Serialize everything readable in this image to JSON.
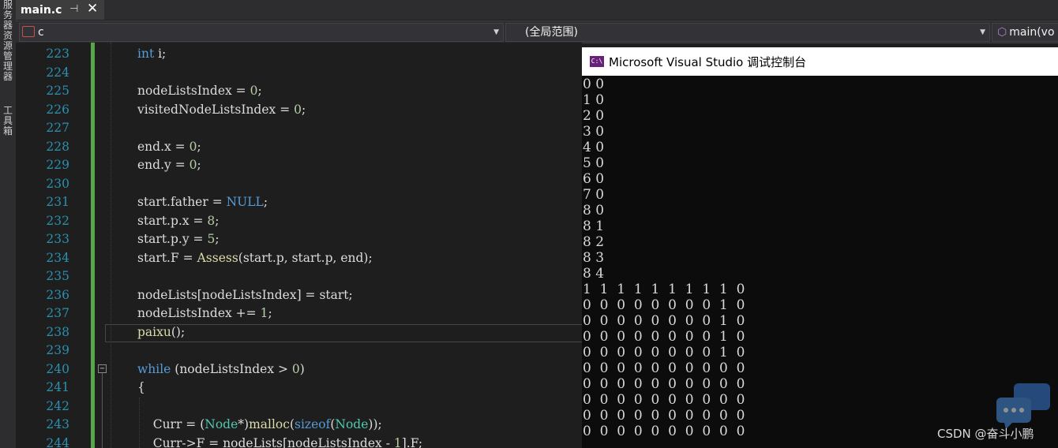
{
  "sidebar": {
    "vertical_text_1": "服务器资源管理器",
    "vertical_text_2": "工具箱"
  },
  "tab": {
    "title": "main.c",
    "pin": "⊣",
    "close": "✕"
  },
  "nav": {
    "project": "c",
    "scope": "(全局范围)",
    "member": "main(vo"
  },
  "editor": {
    "lines": [
      {
        "num": "223",
        "code": "    <span class=\"kw\">int</span> i;"
      },
      {
        "num": "224",
        "code": ""
      },
      {
        "num": "225",
        "code": "    nodeListsIndex = <span class=\"num\">0</span>;"
      },
      {
        "num": "226",
        "code": "    visitedNodeListsIndex = <span class=\"num\">0</span>;"
      },
      {
        "num": "227",
        "code": ""
      },
      {
        "num": "228",
        "code": "    end.x = <span class=\"num\">0</span>;"
      },
      {
        "num": "229",
        "code": "    end.y = <span class=\"num\">0</span>;"
      },
      {
        "num": "230",
        "code": ""
      },
      {
        "num": "231",
        "code": "    start.father = <span class=\"kw\">NULL</span>;"
      },
      {
        "num": "232",
        "code": "    start.p.x = <span class=\"num\">8</span>;"
      },
      {
        "num": "233",
        "code": "    start.p.y = <span class=\"num\">5</span>;"
      },
      {
        "num": "234",
        "code": "    start.F = <span class=\"fn\">Assess</span>(start.p, start.p, end);"
      },
      {
        "num": "235",
        "code": ""
      },
      {
        "num": "236",
        "code": "    nodeLists[nodeListsIndex] = start;"
      },
      {
        "num": "237",
        "code": "    nodeListsIndex += <span class=\"num\">1</span>;"
      },
      {
        "num": "238",
        "code": "    <span class=\"fn\">paixu</span>();"
      },
      {
        "num": "239",
        "code": ""
      },
      {
        "num": "240",
        "code": "    <span class=\"kw\">while</span> (nodeListsIndex > <span class=\"num\">0</span>)"
      },
      {
        "num": "241",
        "code": "    {"
      },
      {
        "num": "242",
        "code": ""
      },
      {
        "num": "243",
        "code": "        Curr = (<span class=\"ty\">Node</span>*)<span class=\"fn\">malloc</span>(<span class=\"kw\">sizeof</span>(<span class=\"ty\">Node</span>));"
      },
      {
        "num": "244",
        "code": "        Curr->F = nodeLists[nodeListsIndex - <span class=\"num\">1</span>].F;"
      }
    ]
  },
  "console": {
    "title": "Microsoft Visual Studio 调试控制台",
    "icon_label": "C:\\",
    "lines": [
      "0 0",
      "1 0",
      "2 0",
      "3 0",
      "4 0",
      "5 0",
      "6 0",
      "7 0",
      "8 0",
      "8 1",
      "8 2",
      "8 3",
      "8 4",
      "1  1  1  1  1  1  1  1  1  0",
      "0  0  0  0  0  0  0  0  1  0",
      "0  0  0  0  0  0  0  0  1  0",
      "0  0  0  0  0  0  0  0  1  0",
      "0  0  0  0  0  0  0  0  1  0",
      "0  0  0  0  0  0  0  0  0  0",
      "0  0  0  0  0  0  0  0  0  0",
      "0  0  0  0  0  0  0  0  0  0",
      "0  0  0  0  0  0  0  0  0  0",
      "0  0  0  0  0  0  0  0  0  0"
    ]
  },
  "watermark": "CSDN @奋斗小鹏"
}
